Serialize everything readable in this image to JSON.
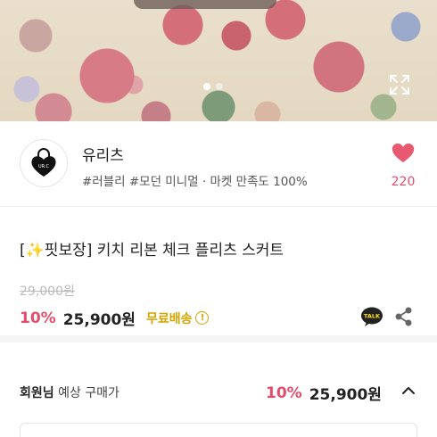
{
  "gallery": {
    "dots": [
      true,
      false
    ],
    "expand_icon": "expand-icon"
  },
  "seller": {
    "name": "유리츠",
    "tags": "#러블리 #모던 미니멀 · 마켓 만족도 100%",
    "avatar_icon": "heart-lock-logo-icon",
    "like_count": "220",
    "like_icon": "heart-icon",
    "accent_color": "#e24d6b"
  },
  "product": {
    "title": "[✨핏보장] 키치 리본 체크 플리츠 스커트",
    "original_price": "29,000원",
    "discount": "10%",
    "price": "25,900원",
    "shipping": "무료배송",
    "shipping_color": "#d4a400",
    "info_icon": "info-icon",
    "talk_icon": "kakao-talk-icon",
    "share_icon": "share-icon"
  },
  "member": {
    "label_strong": "회원님",
    "label_rest": " 예상 구매가",
    "discount": "10%",
    "price": "25,900원",
    "chevron_icon": "chevron-up-icon"
  }
}
